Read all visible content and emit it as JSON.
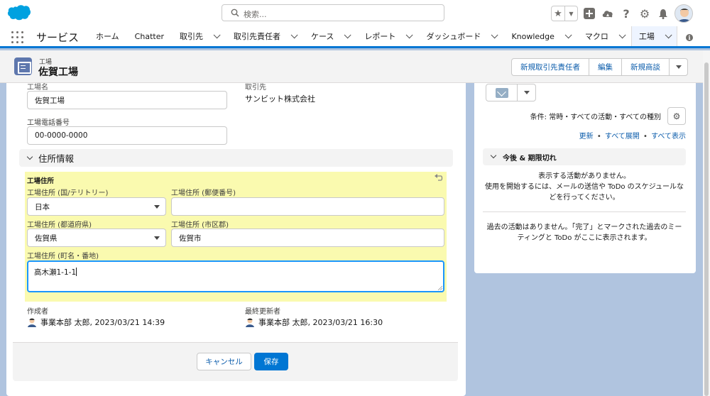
{
  "header": {
    "search_placeholder": "検索..."
  },
  "nav": {
    "app_name": "サービス",
    "items": [
      {
        "label": "ホーム",
        "has_menu": false
      },
      {
        "label": "Chatter",
        "has_menu": false
      },
      {
        "label": "取引先",
        "has_menu": true
      },
      {
        "label": "取引先責任者",
        "has_menu": true
      },
      {
        "label": "ケース",
        "has_menu": true
      },
      {
        "label": "レポート",
        "has_menu": true
      },
      {
        "label": "ダッシュボード",
        "has_menu": true
      },
      {
        "label": "Knowledge",
        "has_menu": true
      },
      {
        "label": "マクロ",
        "has_menu": true
      },
      {
        "label": "工場",
        "has_menu": true,
        "active": true
      }
    ]
  },
  "record": {
    "object_label": "工場",
    "name": "佐賀工場",
    "actions": [
      "新規取引先責任者",
      "編集",
      "新規商談"
    ]
  },
  "form": {
    "name_field_label": "工場名",
    "name_value": "佐賀工場",
    "account_label": "取引先",
    "account_value": "サンビット株式会社",
    "phone_label": "工場電話番号",
    "phone_value": "00-0000-0000",
    "section_title": "住所情報",
    "address": {
      "title": "工場住所",
      "country_label": "工場住所 (国/テリトリー)",
      "country_value": "日本",
      "postal_label": "工場住所 (郵便番号)",
      "postal_value": "",
      "state_label": "工場住所 (都道府県)",
      "state_value": "佐賀県",
      "city_label": "工場住所 (市区郡)",
      "city_value": "佐賀市",
      "street_label": "工場住所 (町名・番地)",
      "street_value": "高木瀬1-1-1"
    },
    "created_by_label": "作成者",
    "created_by_value": "事業本部 太郎, 2023/03/21 14:39",
    "modified_by_label": "最終更新者",
    "modified_by_value": "事業本部 太郎, 2023/03/21 16:30",
    "cancel_label": "キャンセル",
    "save_label": "保存"
  },
  "activity": {
    "filter_text": "条件: 常時・すべての活動・すべての種別",
    "link_refresh": "更新",
    "link_expand": "すべて展開",
    "link_show_all": "すべて表示",
    "link_separator": "•",
    "upcoming_title": "今後 & 期限切れ",
    "no_activity_line1": "表示する活動がありません。",
    "no_activity_line2": "使用を開始するには、メールの送信や ToDo のスケジュールな",
    "no_activity_line3": "どを行ってください。",
    "past_line1": "過去の活動はありません。「完了」とマークされた過去のミー",
    "past_line2": "ティングと ToDo がここに表示されます。"
  },
  "colors": {
    "brand_blue": "#0176d3",
    "link_blue": "#0b5cab",
    "page_background": "#b0c4df",
    "highlight_yellow": "#fafaaf",
    "logo_blue": "#00a1e0",
    "record_icon": "#5e77ad"
  },
  "icons": [
    "salesforce-cloud-logo",
    "search-icon",
    "star-icon",
    "chevron-down-icon",
    "plus-icon",
    "trailhead-icon",
    "help-icon",
    "gear-icon",
    "bell-icon",
    "app-launcher-icon",
    "info-icon",
    "record-type-icon",
    "undo-icon",
    "email-icon",
    "user-avatar-icon"
  ]
}
